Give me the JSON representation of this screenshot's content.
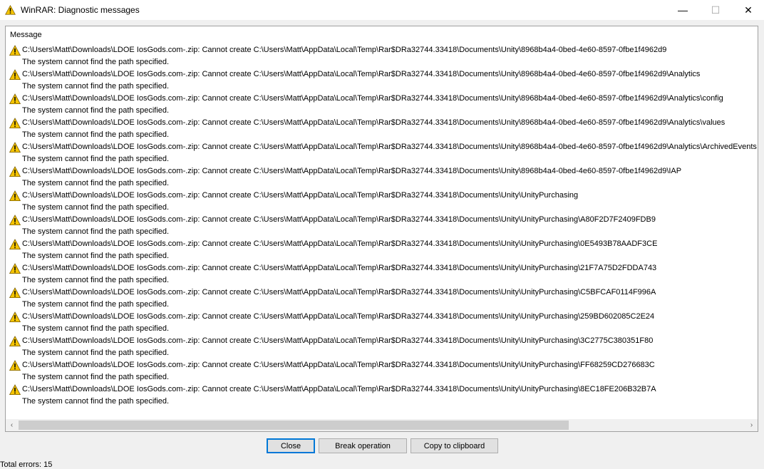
{
  "window": {
    "title": "WinRAR: Diagnostic messages",
    "min_glyph": "—",
    "max_glyph": "☐",
    "close_glyph": "✕",
    "icon": "warning-icon"
  },
  "list": {
    "column_header": "Message",
    "messages": [
      {
        "text": "C:\\Users\\Matt\\Downloads\\LDOE IosGods.com-.zip: Cannot create C:\\Users\\Matt\\AppData\\Local\\Temp\\Rar$DRa32744.33418\\Documents\\Unity\\8968b4a4-0bed-4e60-8597-0fbe1f4962d9",
        "detail": "The system cannot find the path specified."
      },
      {
        "text": "C:\\Users\\Matt\\Downloads\\LDOE IosGods.com-.zip: Cannot create C:\\Users\\Matt\\AppData\\Local\\Temp\\Rar$DRa32744.33418\\Documents\\Unity\\8968b4a4-0bed-4e60-8597-0fbe1f4962d9\\Analytics",
        "detail": "The system cannot find the path specified."
      },
      {
        "text": "C:\\Users\\Matt\\Downloads\\LDOE IosGods.com-.zip: Cannot create C:\\Users\\Matt\\AppData\\Local\\Temp\\Rar$DRa32744.33418\\Documents\\Unity\\8968b4a4-0bed-4e60-8597-0fbe1f4962d9\\Analytics\\config",
        "detail": "The system cannot find the path specified."
      },
      {
        "text": "C:\\Users\\Matt\\Downloads\\LDOE IosGods.com-.zip: Cannot create C:\\Users\\Matt\\AppData\\Local\\Temp\\Rar$DRa32744.33418\\Documents\\Unity\\8968b4a4-0bed-4e60-8597-0fbe1f4962d9\\Analytics\\values",
        "detail": "The system cannot find the path specified."
      },
      {
        "text": "C:\\Users\\Matt\\Downloads\\LDOE IosGods.com-.zip: Cannot create C:\\Users\\Matt\\AppData\\Local\\Temp\\Rar$DRa32744.33418\\Documents\\Unity\\8968b4a4-0bed-4e60-8597-0fbe1f4962d9\\Analytics\\ArchivedEvents",
        "detail": "The system cannot find the path specified."
      },
      {
        "text": "C:\\Users\\Matt\\Downloads\\LDOE IosGods.com-.zip: Cannot create C:\\Users\\Matt\\AppData\\Local\\Temp\\Rar$DRa32744.33418\\Documents\\Unity\\8968b4a4-0bed-4e60-8597-0fbe1f4962d9\\IAP",
        "detail": "The system cannot find the path specified."
      },
      {
        "text": "C:\\Users\\Matt\\Downloads\\LDOE IosGods.com-.zip: Cannot create C:\\Users\\Matt\\AppData\\Local\\Temp\\Rar$DRa32744.33418\\Documents\\Unity\\UnityPurchasing",
        "detail": "The system cannot find the path specified."
      },
      {
        "text": "C:\\Users\\Matt\\Downloads\\LDOE IosGods.com-.zip: Cannot create C:\\Users\\Matt\\AppData\\Local\\Temp\\Rar$DRa32744.33418\\Documents\\Unity\\UnityPurchasing\\A80F2D7F2409FDB9",
        "detail": "The system cannot find the path specified."
      },
      {
        "text": "C:\\Users\\Matt\\Downloads\\LDOE IosGods.com-.zip: Cannot create C:\\Users\\Matt\\AppData\\Local\\Temp\\Rar$DRa32744.33418\\Documents\\Unity\\UnityPurchasing\\0E5493B78AADF3CE",
        "detail": "The system cannot find the path specified."
      },
      {
        "text": "C:\\Users\\Matt\\Downloads\\LDOE IosGods.com-.zip: Cannot create C:\\Users\\Matt\\AppData\\Local\\Temp\\Rar$DRa32744.33418\\Documents\\Unity\\UnityPurchasing\\21F7A75D2FDDA743",
        "detail": "The system cannot find the path specified."
      },
      {
        "text": "C:\\Users\\Matt\\Downloads\\LDOE IosGods.com-.zip: Cannot create C:\\Users\\Matt\\AppData\\Local\\Temp\\Rar$DRa32744.33418\\Documents\\Unity\\UnityPurchasing\\C5BFCAF0114F996A",
        "detail": "The system cannot find the path specified."
      },
      {
        "text": "C:\\Users\\Matt\\Downloads\\LDOE IosGods.com-.zip: Cannot create C:\\Users\\Matt\\AppData\\Local\\Temp\\Rar$DRa32744.33418\\Documents\\Unity\\UnityPurchasing\\259BD602085C2E24",
        "detail": "The system cannot find the path specified."
      },
      {
        "text": "C:\\Users\\Matt\\Downloads\\LDOE IosGods.com-.zip: Cannot create C:\\Users\\Matt\\AppData\\Local\\Temp\\Rar$DRa32744.33418\\Documents\\Unity\\UnityPurchasing\\3C2775C380351F80",
        "detail": "The system cannot find the path specified."
      },
      {
        "text": "C:\\Users\\Matt\\Downloads\\LDOE IosGods.com-.zip: Cannot create C:\\Users\\Matt\\AppData\\Local\\Temp\\Rar$DRa32744.33418\\Documents\\Unity\\UnityPurchasing\\FF68259CD276683C",
        "detail": "The system cannot find the path specified."
      },
      {
        "text": "C:\\Users\\Matt\\Downloads\\LDOE IosGods.com-.zip: Cannot create C:\\Users\\Matt\\AppData\\Local\\Temp\\Rar$DRa32744.33418\\Documents\\Unity\\UnityPurchasing\\8EC18FE206B32B7A",
        "detail": "The system cannot find the path specified."
      }
    ],
    "scroll_left_glyph": "‹",
    "scroll_right_glyph": "›"
  },
  "buttons": {
    "close": "Close",
    "break": "Break operation",
    "copy": "Copy to clipboard"
  },
  "status": {
    "text": "Total errors: 15"
  },
  "colors": {
    "warning_fill": "#f5c400",
    "warning_border": "#7a5c00",
    "accent": "#0078d7"
  }
}
